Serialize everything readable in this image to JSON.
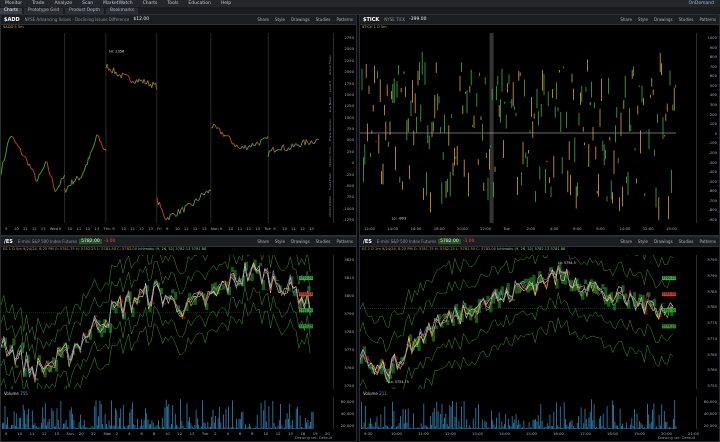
{
  "menu": {
    "items": [
      "Monitor",
      "Trade",
      "Analyze",
      "Scan",
      "MarketWatch",
      "Charts",
      "Tools",
      "Education",
      "Help"
    ],
    "right_label": "OnDemand"
  },
  "tabs": [
    "Charts",
    "Prototype Grid",
    "Product Depth",
    "Bookmarks"
  ],
  "panel_tl": {
    "symbol": "$ADD",
    "desc": "NYSE Advancing Issues - Declining Issues Difference",
    "price": "$12.00",
    "buttons": [
      "Share",
      "Style",
      "Drawings",
      "Studies",
      "Patterns"
    ],
    "interval": "$ADD 5 5m",
    "y_ticks": [
      "2750",
      "2500",
      "2250",
      "2000",
      "1750",
      "1500",
      "1250",
      "1000",
      "750",
      "500",
      "250",
      "0",
      "-250",
      "-500",
      "-750",
      "-1000",
      "-1250"
    ],
    "x_ticks": [
      "9",
      "10",
      "11",
      "12",
      "13",
      "Wed",
      "9",
      "10",
      "11",
      "12",
      "13",
      "Thu",
      "9",
      "10",
      "11",
      "12",
      "13",
      "Fri",
      "9",
      "10",
      "11",
      "12",
      "13",
      "Mon",
      "9",
      "10",
      "11",
      "12",
      "13",
      "Tue",
      "9",
      "10",
      "11",
      "12",
      "13"
    ],
    "hi_label": "Hi: 2358",
    "lo_label": "Lo: -1295",
    "side_tabs": [
      "Active Trader",
      "Level II",
      "Live News",
      "Phase Scanner",
      "Options Time",
      "Trade Flash",
      "Option Mobile"
    ]
  },
  "panel_tr": {
    "symbol": "$TICK",
    "desc": "NYSE TICK",
    "price": "-399.00",
    "buttons": [
      "Share",
      "Style",
      "Drawings",
      "Studies",
      "Patterns"
    ],
    "interval": "$TICK 1 D 5m",
    "y_ticks": [
      "1000",
      "900",
      "800",
      "700",
      "600",
      "500",
      "400",
      "300",
      "200",
      "100",
      "0",
      "-100",
      "-200",
      "-300",
      "-400",
      "-500",
      "-600",
      "-700",
      "-800",
      "-900"
    ],
    "x_ticks": [
      "12:00",
      "14:00",
      "16:00",
      "18:00",
      "20:00",
      "22:00",
      "Tue",
      "2:00",
      "4:00",
      "6:00",
      "8:00",
      "10:00",
      "12:00",
      "15:00"
    ],
    "lo_label": "Lo: -803",
    "footer": "Drawing set: Default"
  },
  "panel_bl": {
    "symbol": "/ES",
    "desc": "E-mini S&P 500 Index Futures",
    "price": "5782.00",
    "change": "-3.00",
    "buttons": [
      "Share",
      "Style",
      "Drawings",
      "Studies",
      "Patterns"
    ],
    "study_line": "ES 1 D 5m  9/24/24, 8:25 PM  O: 5781.75  H: 5782.25  L: 5781.50  C: 5782.00",
    "study_line2": "Ichimoku (9, 26, 52)  5782.13  5781.88",
    "y_ticks": [
      "5820",
      "5810",
      "5800",
      "5790",
      "5780",
      "5770",
      "5760",
      "5750"
    ],
    "x_ticks": [
      "9",
      "10",
      "11",
      "12",
      "13",
      "Sun",
      "20",
      "22",
      "Mon",
      "2",
      "4",
      "6",
      "8",
      "10",
      "12",
      "13",
      "Tue",
      "2",
      "4",
      "6",
      "8",
      "10",
      "12",
      "13",
      "18",
      "19",
      "20"
    ],
    "right_tags": [
      "5792.25",
      "5785.75",
      "5782.00",
      "5773.25"
    ],
    "volume_label": "Volume",
    "volume_value": "755",
    "vol_ticks": [
      "60,000",
      "40,000",
      "20,000"
    ],
    "footer": "Drawing set: Default"
  },
  "panel_br": {
    "symbol": "/ES",
    "desc": "E-mini S&P 500 Index Futures",
    "price": "5782.00",
    "change": "-3.00",
    "buttons": [
      "Share",
      "Style",
      "Drawings",
      "Studies",
      "Patterns"
    ],
    "study_line": "ES 1 D 1m  9/24/24, 8:25 PM  O: 5781.75  H: 5782.25  L: 5781.50  C: 5782.00",
    "study_line2": "Ichimoku (9, 26, 52)  5782.13  5781.88",
    "hi_label": "Hi: 5794.5",
    "lo_label": "Lo: 5754.75",
    "y_ticks": [
      "5795",
      "5790",
      "5785",
      "5780",
      "5775",
      "5770",
      "5765",
      "5760",
      "5755"
    ],
    "x_ticks": [
      "9:30",
      "10:00",
      "11:00",
      "12:00",
      "13:00",
      "14:00",
      "15:00",
      "16:00",
      "17:00",
      "18:00",
      "19:00",
      "20:00",
      "21:00"
    ],
    "right_tags": [
      "5790.25",
      "5785.00",
      "5782.00",
      "5776.25"
    ],
    "volume_label": "Volume",
    "volume_value": "211",
    "vol_ticks": [
      "60,000",
      "40,000",
      "20,000"
    ],
    "footer": "Drawing set: Default"
  },
  "colors": {
    "up": "#3fae3f",
    "down": "#d04030",
    "cloud_green": "#1f7a1f",
    "cloud_red": "#7a1f1f",
    "axis_text": "#a8adb4"
  }
}
